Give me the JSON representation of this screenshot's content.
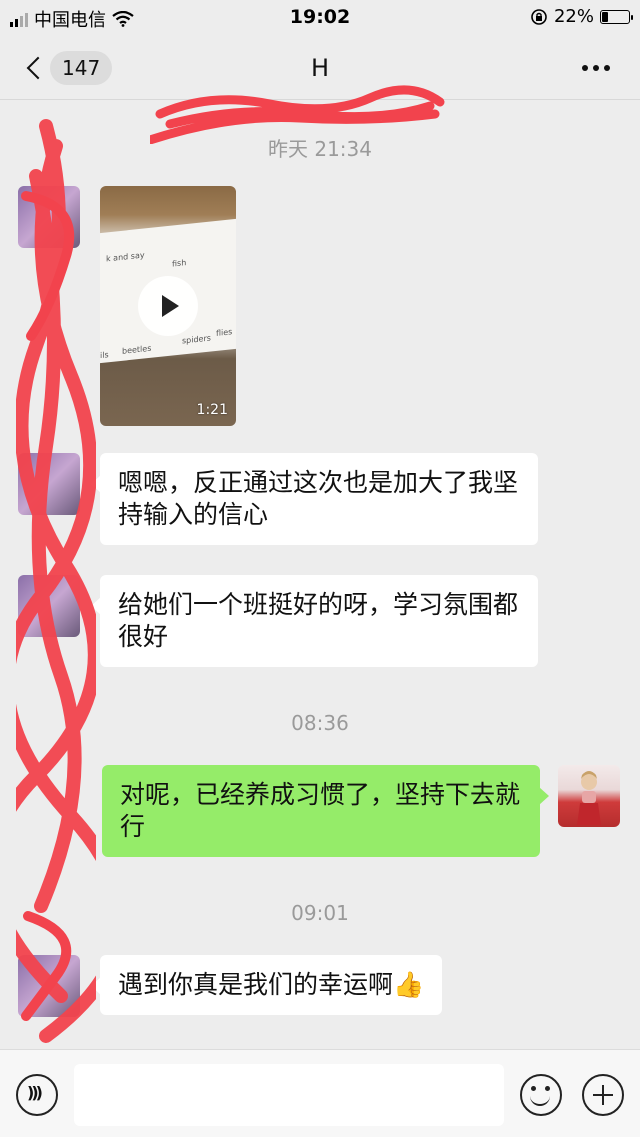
{
  "status_bar": {
    "carrier": "中国电信",
    "time": "19:02",
    "battery": "22%",
    "battery_level": 0.22
  },
  "nav": {
    "back_icon": "chevron-left-icon",
    "unread_count": "147",
    "title": "H",
    "more_icon": "more-dots-icon"
  },
  "chat": {
    "timestamps": [
      "昨天 21:34",
      "08:36",
      "09:01"
    ],
    "video": {
      "duration": "1:21",
      "paper_text": [
        "k and say",
        "fish",
        "beetles",
        "spiders",
        "flies",
        "ils"
      ]
    },
    "messages": [
      {
        "side": "left",
        "text": "嗯嗯，反正通过这次也是加大了我坚持输入的信心"
      },
      {
        "side": "left",
        "text": "给她们一个班挺好的呀，学习氛围都很好"
      },
      {
        "side": "right",
        "text": "对呢，已经养成习惯了，坚持下去就行"
      },
      {
        "side": "left",
        "text": "遇到你真是我们的幸运啊👍"
      }
    ]
  },
  "input_bar": {
    "voice_icon": "voice-icon",
    "emoji_icon": "emoji-icon",
    "plus_icon": "plus-icon",
    "placeholder": ""
  },
  "colors": {
    "background": "#ededed",
    "outgoing_bubble": "#95ec69",
    "incoming_bubble": "#ffffff",
    "redaction": "#f2434d"
  }
}
